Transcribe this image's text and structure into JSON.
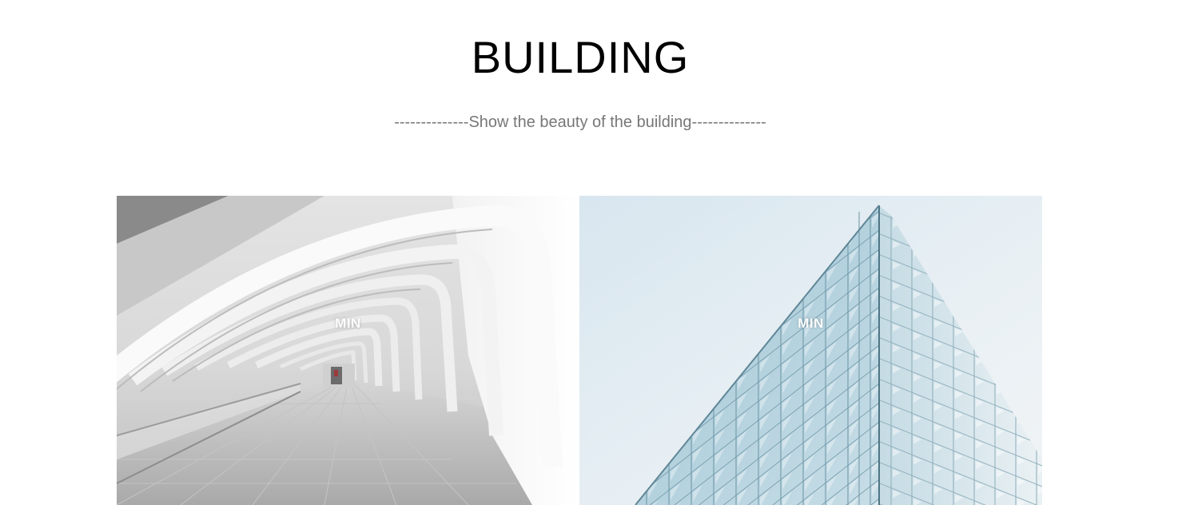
{
  "header": {
    "title": "BUILDING",
    "subtitle": "--------------Show the beauty of the building--------------"
  },
  "gallery": {
    "items": [
      {
        "label": "MIN",
        "image": "white-arched-corridor"
      },
      {
        "label": "MIN",
        "image": "glass-facade-building"
      }
    ]
  },
  "colors": {
    "title": "#000000",
    "subtitle": "#777777",
    "background": "#ffffff"
  }
}
